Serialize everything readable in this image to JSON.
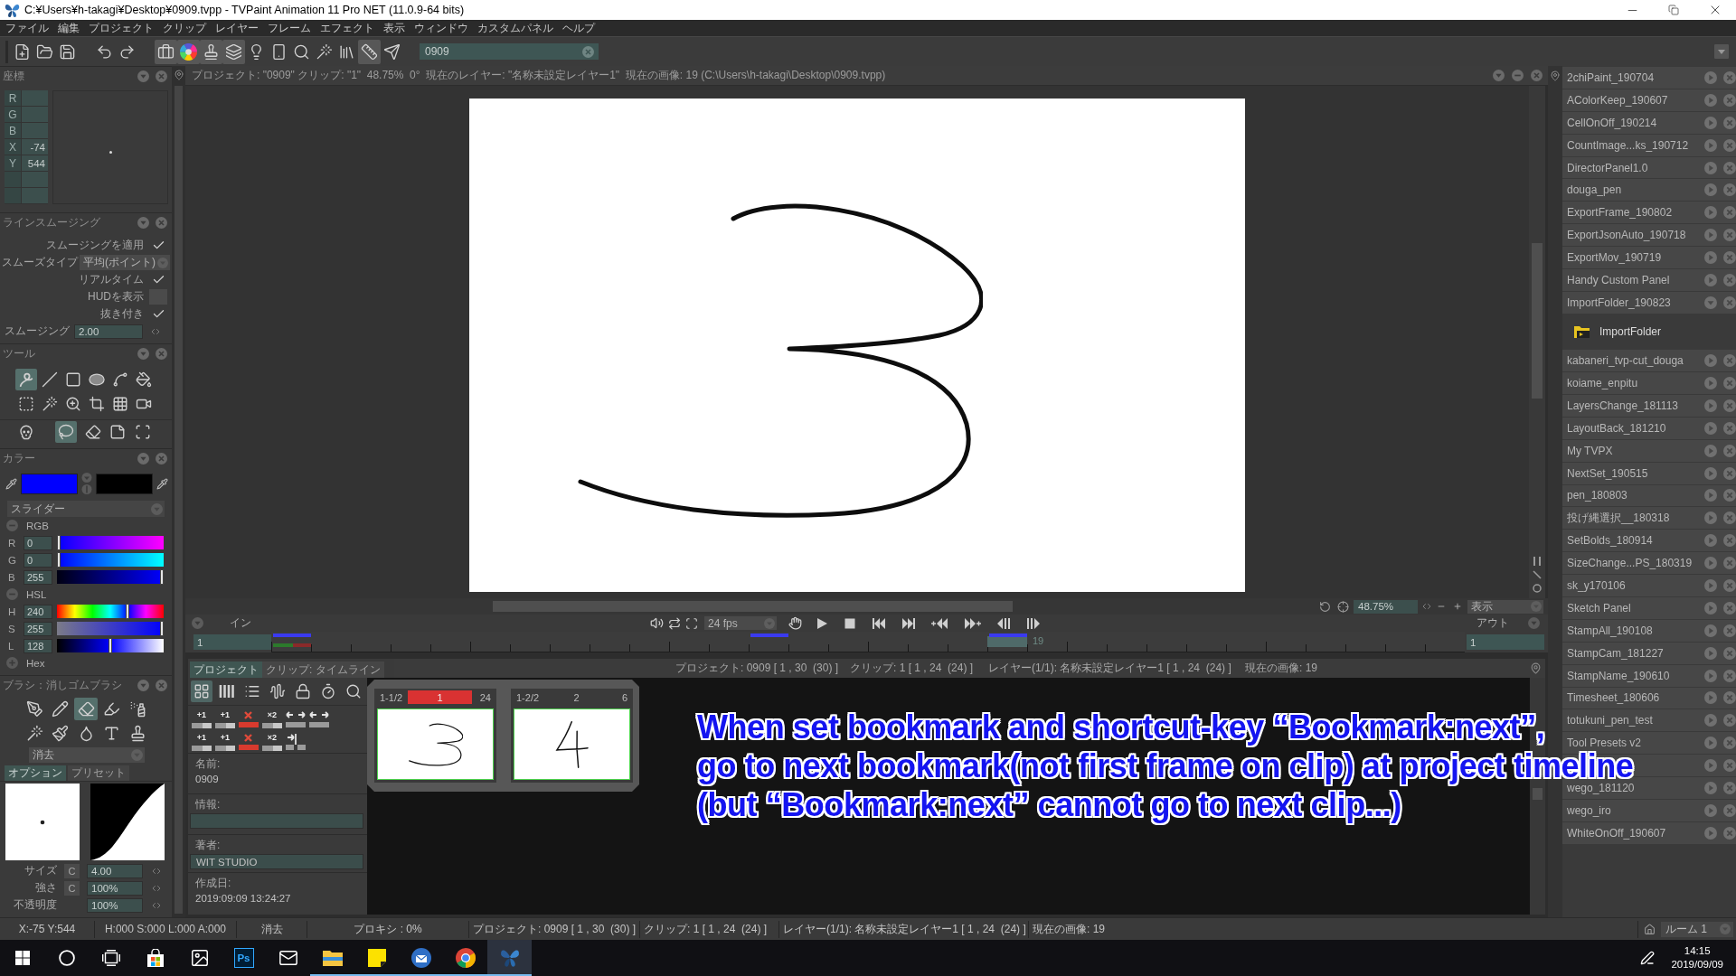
{
  "window": {
    "title": "C:¥Users¥h-takagi¥Desktop¥0909.tvpp - TVPaint Animation 11 Pro NET (11.0.9-64 bits)"
  },
  "menu": [
    "ファイル",
    "編集",
    "プロジェクト",
    "クリップ",
    "レイヤー",
    "フレーム",
    "エフェクト",
    "表示",
    "ウィンドウ",
    "カスタムパネル",
    "ヘルプ"
  ],
  "toolbar": {
    "buttons": [
      {
        "kind": "new",
        "on": false
      },
      {
        "kind": "open",
        "on": false
      },
      {
        "kind": "save",
        "on": false
      },
      {
        "kind": "undo",
        "on": false
      },
      {
        "kind": "redo",
        "on": false
      },
      {
        "kind": "toolbox",
        "on": true
      },
      {
        "kind": "colorwheel",
        "on": true
      },
      {
        "kind": "stamp",
        "on": true
      },
      {
        "kind": "layers",
        "on": true
      },
      {
        "kind": "bulb",
        "on": false
      },
      {
        "kind": "remote",
        "on": false
      },
      {
        "kind": "search",
        "on": false
      },
      {
        "kind": "wand",
        "on": false
      },
      {
        "kind": "books",
        "on": false
      },
      {
        "kind": "ruler",
        "on": true
      },
      {
        "kind": "plane",
        "on": false
      }
    ],
    "search": {
      "value": "0909"
    }
  },
  "coordinates": {
    "title": "座標",
    "rows": [
      {
        "label": "R"
      },
      {
        "label": "G"
      },
      {
        "label": "B"
      },
      {
        "label": "X",
        "value": "-74"
      },
      {
        "label": "Y",
        "value": "544"
      }
    ]
  },
  "line_smoothing": {
    "title": "ラインスムージング",
    "rows": [
      {
        "kind": "check",
        "label": "スムージングを適用",
        "checked": true
      },
      {
        "kind": "select",
        "label": "スムーズタイプ",
        "value": "平均(ポイント)"
      },
      {
        "kind": "check",
        "label": "リアルタイム",
        "checked": true
      },
      {
        "kind": "check",
        "label": "HUDを表示",
        "checked": false
      },
      {
        "kind": "check",
        "label": "抜き付き",
        "checked": true
      },
      {
        "kind": "number",
        "label": "スムージング",
        "value": "2.00"
      }
    ]
  },
  "tools": {
    "title": "ツール",
    "rows": [
      {
        "items": [
          {
            "kind": "freehand",
            "selected": true
          },
          {
            "kind": "line",
            "selected": false
          },
          {
            "kind": "rectangle",
            "selected": false
          },
          {
            "kind": "ellipse",
            "selected": false
          },
          {
            "kind": "curve",
            "selected": false
          },
          {
            "kind": "fill",
            "selected": false
          }
        ]
      },
      {
        "items": [
          {
            "kind": "select",
            "selected": false
          },
          {
            "kind": "wand",
            "selected": false
          },
          {
            "kind": "warp",
            "selected": false
          },
          {
            "kind": "crop",
            "selected": false
          },
          {
            "kind": "grid",
            "selected": false
          },
          {
            "kind": "camera",
            "selected": false
          }
        ]
      },
      {
        "items": [
          {
            "kind": "skull",
            "selected": false
          },
          {
            "kind": "custom",
            "selected": true
          },
          {
            "kind": "eraser",
            "selected": false
          },
          {
            "kind": "paper",
            "selected": false
          },
          {
            "kind": "stencil",
            "selected": false
          }
        ]
      }
    ]
  },
  "color": {
    "title": "カラー",
    "swatches": [
      {
        "color": "#0000ff"
      },
      {
        "color": "#000000"
      }
    ],
    "mode": "スライダー",
    "groups": [
      {
        "label": "RGB",
        "expanded": true,
        "channels": [
          {
            "kind": "red",
            "label": "R",
            "value": "0",
            "level": 0
          },
          {
            "kind": "green",
            "label": "G",
            "value": "0",
            "level": 0
          },
          {
            "kind": "blue",
            "label": "B",
            "value": "255",
            "level": 1
          }
        ]
      },
      {
        "label": "HSL",
        "expanded": true,
        "channels": [
          {
            "kind": "hue",
            "label": "H",
            "value": "240",
            "level": 0.667
          },
          {
            "kind": "saturation",
            "label": "S",
            "value": "255",
            "level": 1
          },
          {
            "kind": "lightness",
            "label": "L",
            "value": "128",
            "level": 0.5
          }
        ]
      },
      {
        "label": "Hex",
        "expanded": false
      }
    ]
  },
  "brush": {
    "title": "ブラシ：消しゴムブラシ",
    "rows": [
      {
        "items": [
          {
            "kind": "pen",
            "selected": false
          },
          {
            "kind": "pencil",
            "selected": false
          },
          {
            "kind": "eraser",
            "selected": true
          },
          {
            "kind": "marker",
            "selected": false
          },
          {
            "kind": "airbrush",
            "selected": false
          }
        ]
      },
      {
        "items": [
          {
            "kind": "special",
            "selected": false
          },
          {
            "kind": "paintbrush",
            "selected": false
          },
          {
            "kind": "water",
            "selected": false
          },
          {
            "kind": "text",
            "selected": false
          },
          {
            "kind": "spray",
            "selected": false
          }
        ]
      }
    ],
    "mode": "消去",
    "tabs": [
      {
        "label": "オプション",
        "selected": true
      },
      {
        "label": "プリセット",
        "selected": false
      }
    ],
    "params": [
      {
        "label": "サイズ",
        "button": "C",
        "value": "4.00"
      },
      {
        "label": "強さ",
        "button": "C",
        "value": "100%"
      },
      {
        "label": "不透明度",
        "value": "100%"
      }
    ]
  },
  "canvas": {
    "info": "プロジェクト: \"0909\" クリップ: \"1\"  48.75%  0°  現在のレイヤー: \"名称未設定レイヤー1\"  現在の画像: 19 (C:\\Users\\h-takagi\\Desktop\\0909.tvpp)",
    "zoom": "48.75%",
    "view": "表示"
  },
  "timeline": {
    "in_label": "イン",
    "in_value": "1",
    "fps": "24 fps",
    "out_label": "アウト",
    "out_value": "1",
    "current_frame": "19"
  },
  "project_panel": {
    "tabs": [
      {
        "label": "プロジェクト",
        "selected": true
      },
      {
        "label": "クリップ: タイムライン",
        "selected": false
      }
    ],
    "info": [
      "プロジェクト: 0909 [ 1 , 30  (30) ]",
      "クリップ: 1 [ 1 , 24  (24) ]",
      "レイヤー(1/1): 名称未設定レイヤー1 [ 1 , 24  (24) ]",
      "現在の画像: 19"
    ],
    "views": [
      {
        "kind": "grid",
        "selected": true
      },
      {
        "kind": "columns",
        "selected": false
      },
      {
        "kind": "list",
        "selected": false
      },
      {
        "kind": "waveform",
        "selected": false
      },
      {
        "kind": "lock",
        "selected": false
      },
      {
        "kind": "timer",
        "selected": false
      },
      {
        "kind": "search",
        "selected": false
      }
    ],
    "edit_rows": [
      {
        "buttons": [
          {
            "kind": "add",
            "label": "+1"
          },
          {
            "kind": "add",
            "label": "+1"
          },
          {
            "kind": "delete"
          },
          {
            "kind": "add",
            "label": "×2"
          },
          {
            "kind": "move"
          },
          {
            "kind": "move"
          }
        ]
      },
      {
        "buttons": [
          {
            "kind": "add",
            "label": "+1"
          },
          {
            "kind": "add",
            "label": "+1"
          },
          {
            "kind": "delete"
          },
          {
            "kind": "add",
            "label": "×2"
          },
          {
            "kind": "split"
          }
        ]
      }
    ],
    "fields": [
      {
        "kind": "text",
        "label": "名前:",
        "value": "0909"
      },
      {
        "kind": "input",
        "label": "情報:"
      },
      {
        "kind": "input",
        "label": "著者:",
        "value": "WIT STUDIO"
      },
      {
        "kind": "text",
        "label": "作成日:",
        "value": "2019:09:09 13:24:27"
      }
    ],
    "clips": [
      {
        "label": "1-1/2",
        "number": "1",
        "frames": "24",
        "selected": true
      },
      {
        "label": "1-2/2",
        "number": "2",
        "frames": "6",
        "selected": false
      }
    ]
  },
  "annotation": {
    "lines": [
      "When set bookmark and shortcut-key “Bookmark:next”,",
      "go to next bookmark(not first frame on clip) at project timeline",
      "(but “Bookmark:next” cannot go to next clip...)"
    ]
  },
  "extensions": {
    "items": [
      {
        "label": "2chiPaint_190704",
        "expanded": false
      },
      {
        "label": "AColorKeep_190607",
        "expanded": false
      },
      {
        "label": "CellOnOff_190214",
        "expanded": false
      },
      {
        "label": "CountImage...ks_190712",
        "expanded": false
      },
      {
        "label": "DirectorPanel1.0",
        "expanded": false
      },
      {
        "label": "douga_pen",
        "expanded": false
      },
      {
        "label": "ExportFrame_190802",
        "expanded": false
      },
      {
        "label": "ExportJsonAuto_190718",
        "expanded": false
      },
      {
        "label": "ExportMov_190719",
        "expanded": false
      },
      {
        "label": "Handy Custom Panel",
        "expanded": false
      },
      {
        "label": "ImportFolder_190823",
        "expanded": true,
        "children": [
          {
            "label": "ImportFolder"
          }
        ]
      },
      {
        "label": "kabaneri_tvp-cut_douga",
        "expanded": false
      },
      {
        "label": "koiame_enpitu",
        "expanded": false
      },
      {
        "label": "LayersChange_181113",
        "expanded": false
      },
      {
        "label": "LayoutBack_181210",
        "expanded": false
      },
      {
        "label": "My TVPX",
        "expanded": false
      },
      {
        "label": "NextSet_190515",
        "expanded": false
      },
      {
        "label": "pen_180803",
        "expanded": false
      },
      {
        "label": "投げ縄選択__180318",
        "expanded": false
      },
      {
        "label": "SetBolds_180914",
        "expanded": false
      },
      {
        "label": "SizeChange...PS_180319",
        "expanded": false
      },
      {
        "label": "sk_y170106",
        "expanded": false
      },
      {
        "label": "Sketch Panel",
        "expanded": false
      },
      {
        "label": "StampAll_190108",
        "expanded": false
      },
      {
        "label": "StampCam_181227",
        "expanded": false
      },
      {
        "label": "StampName_190610",
        "expanded": false
      },
      {
        "label": "Timesheet_180606",
        "expanded": false
      },
      {
        "label": "totukuni_pen_test",
        "expanded": false
      },
      {
        "label": "Tool Presets v2",
        "expanded": false
      },
      {
        "expanded": false
      },
      {
        "label": "wego_181120",
        "expanded": false
      },
      {
        "label": "wego_iro",
        "expanded": false
      },
      {
        "label": "WhiteOnOff_190607",
        "expanded": false
      }
    ]
  },
  "status_bar": {
    "cells": [
      "X:-75 Y:544",
      "H:000 S:000 L:000 A:000",
      "消去",
      "プロキシ : 0%",
      "プロジェクト: 0909 [ 1 , 30  (30) ]",
      "クリップ: 1 [ 1 , 24  (24) ]",
      "レイヤー(1/1): 名称未設定レイヤー1 [ 1 , 24  (24) ]",
      "現在の画像: 19"
    ],
    "room": "ルーム 1"
  },
  "taskbar": {
    "apps": [
      {
        "kind": "start",
        "running": false,
        "selected": false
      },
      {
        "kind": "search",
        "running": false,
        "selected": false
      },
      {
        "kind": "taskview",
        "running": false,
        "selected": false
      },
      {
        "kind": "store",
        "running": false,
        "selected": false
      },
      {
        "kind": "photos",
        "running": false,
        "selected": false
      },
      {
        "kind": "photoshop",
        "label": "Ps",
        "running": false,
        "selected": false
      },
      {
        "kind": "mail",
        "running": false,
        "selected": false
      },
      {
        "kind": "explorer",
        "running": true,
        "selected": false
      },
      {
        "kind": "notes",
        "running": true,
        "selected": false
      },
      {
        "kind": "thunderbird",
        "running": true,
        "selected": false
      },
      {
        "kind": "chrome",
        "running": true,
        "selected": false
      },
      {
        "kind": "tvpaint",
        "running": true,
        "selected": true
      }
    ],
    "time": "14:15",
    "date": "2019/09/09"
  }
}
